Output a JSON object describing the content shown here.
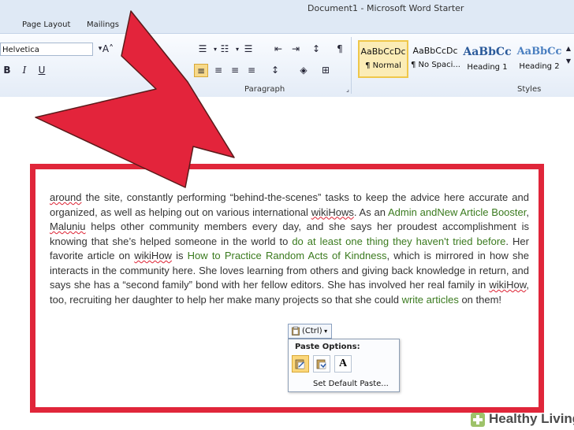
{
  "window": {
    "title": "Document1 - Microsoft Word Starter"
  },
  "tabs": [
    "Page Layout",
    "Mailings"
  ],
  "ribbon": {
    "font_name": "Helvetica",
    "group_paragraph": "Paragraph",
    "group_styles": "Styles",
    "styles": [
      {
        "sample": "AaBbCcDc",
        "name": "¶ Normal"
      },
      {
        "sample": "AaBbCcDc",
        "name": "¶ No Spaci..."
      },
      {
        "sample": "AaBbCc",
        "name": "Heading 1"
      },
      {
        "sample": "AaBbCc",
        "name": "Heading 2"
      }
    ],
    "font_buttons": {
      "bold": "B",
      "italic": "I",
      "underline": "U"
    }
  },
  "document": {
    "segments": [
      {
        "t": "around",
        "cls": "squiggle"
      },
      {
        "t": " the site, constantly performing “behind-the-scenes” tasks to keep the advice here accurate and organized, as well as helping out on various international "
      },
      {
        "t": "wikiHows",
        "cls": "squiggle"
      },
      {
        "t": ". As an "
      },
      {
        "t": "Admin",
        "cls": "link"
      },
      {
        "t": " "
      },
      {
        "t": "andNew Article Booster",
        "cls": "link"
      },
      {
        "t": ", "
      },
      {
        "t": "Maluniu",
        "cls": "squiggle"
      },
      {
        "t": " helps other community members every day, and she says her proudest accomplishment is knowing that she’s helped someone in the world to "
      },
      {
        "t": "do at least one thing they haven't tried before",
        "cls": "link"
      },
      {
        "t": ". Her favorite article on "
      },
      {
        "t": "wikiHow",
        "cls": "squiggle"
      },
      {
        "t": " is "
      },
      {
        "t": "How to Practice Random Acts of Kindness",
        "cls": "link"
      },
      {
        "t": ", which is mirrored in how she interacts in the community here. She loves learning from others and giving back knowledge in return, and says she has a “second family” bond with her fellow editors. She has involved her real family in "
      },
      {
        "t": "wikiHow",
        "cls": "squiggle"
      },
      {
        "t": ", too, recruiting her daughter to help her make many projects so that she could "
      },
      {
        "t": "write articles",
        "cls": "link"
      },
      {
        "t": " on them!"
      }
    ]
  },
  "paste": {
    "ctrl_label": "(Ctrl)",
    "menu_title": "Paste Options:",
    "set_default": "Set Default Paste...",
    "option_text_only": "A"
  },
  "watermark": {
    "text": "Healthy Living"
  },
  "colors": {
    "highlight": "#e0263a",
    "link": "#3a7a1e",
    "arrow": "#e3243b"
  },
  "icons": [
    "clipboard-icon",
    "paste-keep-source-icon",
    "paste-merge-icon",
    "paste-text-only-icon",
    "pilcrow-icon",
    "bullets-icon",
    "numbering-icon"
  ]
}
